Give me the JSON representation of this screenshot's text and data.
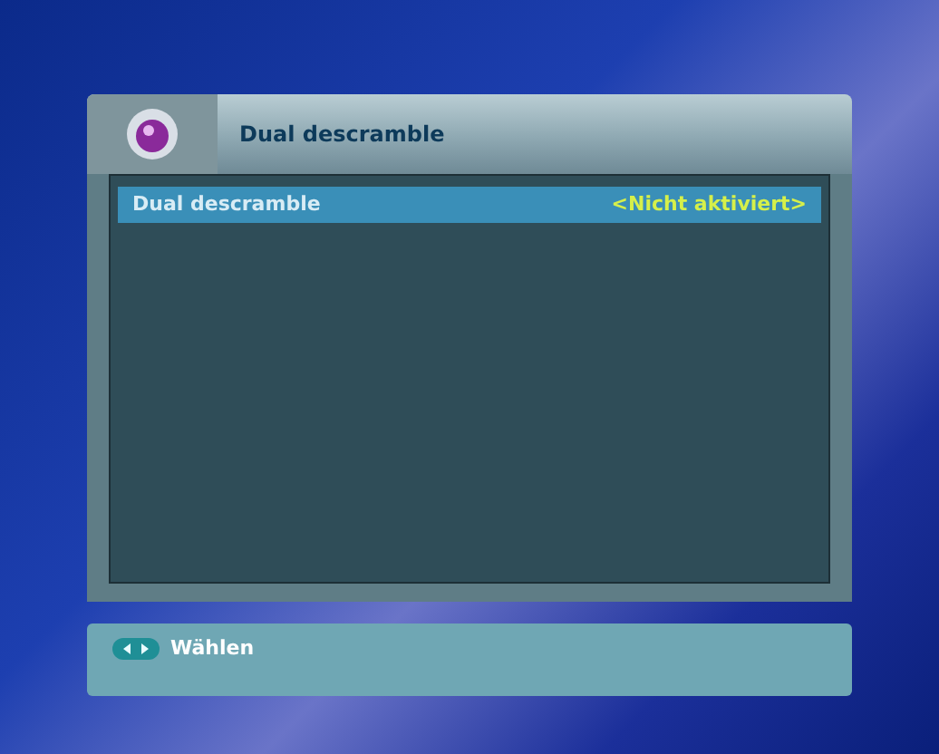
{
  "header": {
    "title": "Dual descramble"
  },
  "menu_items": [
    {
      "label": "Dual descramble",
      "value": "<Nicht aktiviert>",
      "selected": true
    }
  ],
  "footer": {
    "hint": "Wählen"
  }
}
